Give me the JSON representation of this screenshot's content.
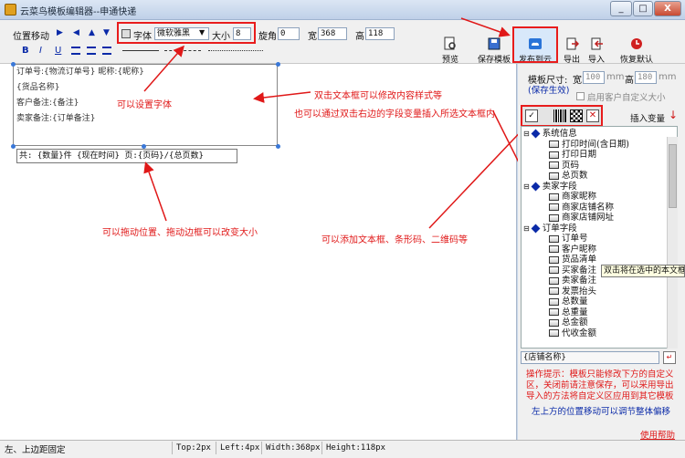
{
  "window": {
    "title": "云菜鸟模板编辑器--申通快递",
    "buttons": [
      "_",
      "□",
      "X"
    ]
  },
  "toolbar": {
    "move_label": "位置移动",
    "font_label": "字体",
    "font_value": "微软雅黑",
    "size_label": "大小",
    "size_value": "8",
    "rotate_label": "旋角",
    "rotate_value": "0",
    "width_label": "宽",
    "width_value": "368",
    "height_label": "高",
    "height_value": "118",
    "bold": "B",
    "italic": "I",
    "underline": "U",
    "preview": "预览",
    "save_template": "保存模板",
    "publish_cloud": "发布到云",
    "export": "导出",
    "import": "导入",
    "restore_default": "恢复默认"
  },
  "label": {
    "lines": [
      "订单号:{物流订单号} 昵称:{昵称}",
      "{货品名称}",
      "客户备注:{备注}",
      "卖家备注:{订单备注}"
    ],
    "footer": "共: {数量}件  {现在时间}  页:{页码}/{总页数}"
  },
  "annotations": {
    "set_font": "可以设置字体",
    "dblclick_edit": "双击文本框可以修改内容样式等",
    "dblclick_insert": "也可以通过双击右边的字段变量插入所选文本框内",
    "drag_resize": "可以拖动位置、拖动边框可以改变大小",
    "add_items": "可以添加文本框、条形码、二维码等"
  },
  "right_panel": {
    "template_size_label": "模板尺寸:",
    "width_label": "宽",
    "width_value": "100",
    "width_unit": "mm",
    "height_label": "高",
    "height_value": "180",
    "height_unit": "mm",
    "save_effective": "(保存生效)",
    "custom_size": "启用客户自定义大小",
    "insert_variable": "插入变量",
    "tree": [
      {
        "type": "group",
        "label": "系统信息"
      },
      {
        "type": "item",
        "label": "打印时间(含日期)"
      },
      {
        "type": "item",
        "label": "打印日期"
      },
      {
        "type": "item",
        "label": "页码"
      },
      {
        "type": "item",
        "label": "总页数"
      },
      {
        "type": "group",
        "label": "卖家字段"
      },
      {
        "type": "item",
        "label": "商家昵称"
      },
      {
        "type": "item",
        "label": "商家店铺名称"
      },
      {
        "type": "item",
        "label": "商家店铺网址"
      },
      {
        "type": "group",
        "label": "订单字段"
      },
      {
        "type": "item",
        "label": "订单号"
      },
      {
        "type": "item",
        "label": "客户昵称"
      },
      {
        "type": "item",
        "label": "货品清单"
      },
      {
        "type": "item",
        "label": "买家备注"
      },
      {
        "type": "item",
        "label": "卖家备注"
      },
      {
        "type": "item",
        "label": "发票抬头"
      },
      {
        "type": "item",
        "label": "总数量"
      },
      {
        "type": "item",
        "label": "总重量"
      },
      {
        "type": "item",
        "label": "总金额"
      },
      {
        "type": "item",
        "label": "代收金额"
      }
    ],
    "tooltip": "双击将在选中的本文框",
    "preview_value": "{店铺名称}",
    "tip_text": "操作提示：模板只能修改下方的自定义区，关闭前请注意保存，可以采用导出导入的方法将自定义区应用到其它模板",
    "move_tip": "左上方的位置移动可以调节整体偏移",
    "help_link": "使用帮助"
  },
  "status": {
    "left": "左、上边距固定",
    "top": "Top:2px",
    "left_px": "Left:4px",
    "width": "Width:368px",
    "height": "Height:118px"
  },
  "colors": {
    "annotation": "#e01818",
    "accent_blue": "#0a2aa8",
    "link_blue": "#1e3d8c"
  }
}
